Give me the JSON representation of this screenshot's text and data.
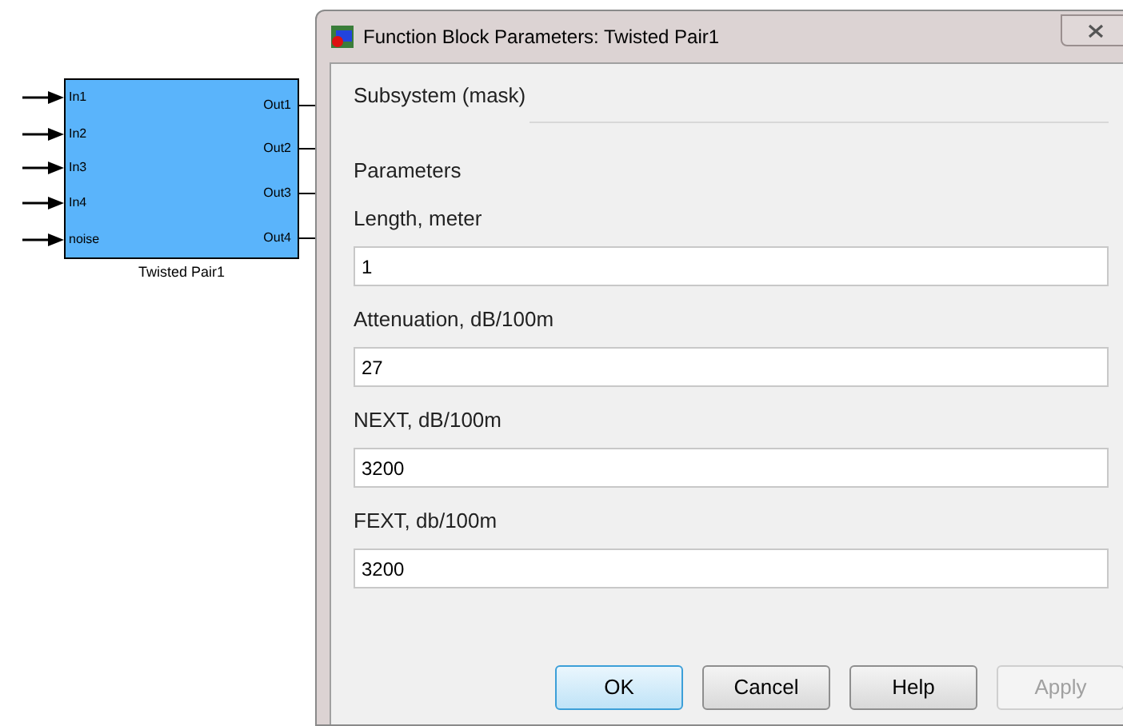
{
  "block": {
    "name": "Twisted Pair1",
    "inputs": [
      "In1",
      "In2",
      "In3",
      "In4",
      "noise"
    ],
    "outputs": [
      "Out1",
      "Out2",
      "Out3",
      "Out4"
    ]
  },
  "dialog": {
    "title": "Function Block Parameters: Twisted Pair1",
    "mask_title": "Subsystem (mask)",
    "parameters_title": "Parameters",
    "fields": [
      {
        "label": "Length, meter",
        "value": "1"
      },
      {
        "label": "Attenuation, dB/100m",
        "value": "27"
      },
      {
        "label": "NEXT, dB/100m",
        "value": "3200"
      },
      {
        "label": "FEXT, db/100m",
        "value": "3200"
      }
    ],
    "buttons": [
      {
        "label": "OK",
        "default": true,
        "disabled": false
      },
      {
        "label": "Cancel",
        "default": false,
        "disabled": false
      },
      {
        "label": "Help",
        "default": false,
        "disabled": false
      },
      {
        "label": "Apply",
        "default": false,
        "disabled": true
      }
    ]
  }
}
